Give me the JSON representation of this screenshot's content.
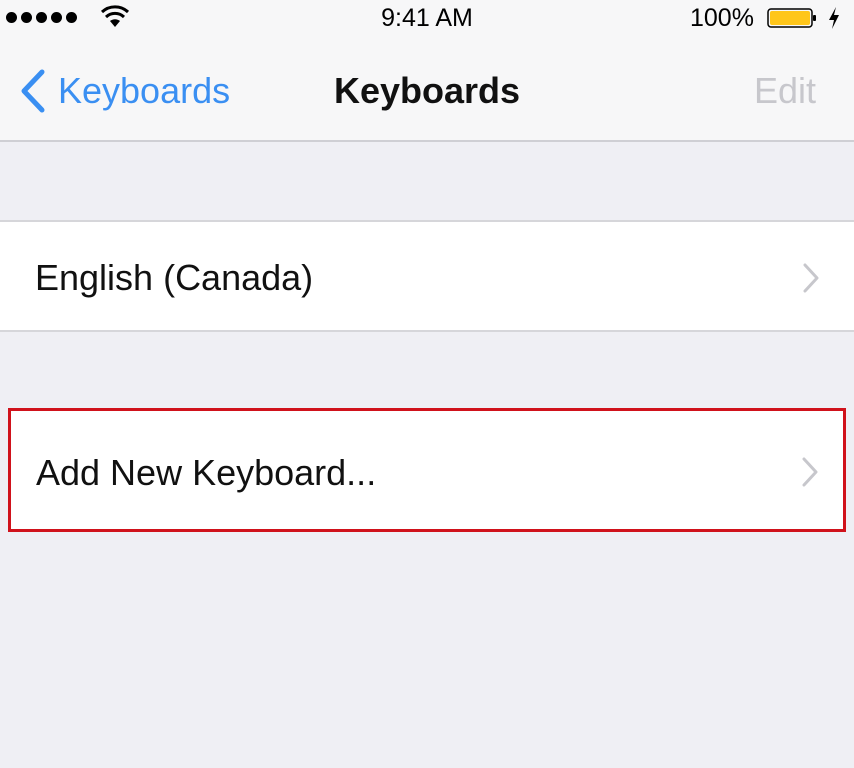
{
  "status_bar": {
    "time": "9:41 AM",
    "battery_percent": "100%",
    "battery_color": "#ffc61a",
    "signal_dots": 5
  },
  "nav": {
    "back_label": "Keyboards",
    "title": "Keyboards",
    "edit_label": "Edit"
  },
  "rows": [
    {
      "label": "English (Canada)"
    },
    {
      "label": "Add New Keyboard..."
    }
  ],
  "colors": {
    "accent": "#3a8ff2",
    "highlight": "#d0121b",
    "background": "#efeff4"
  }
}
